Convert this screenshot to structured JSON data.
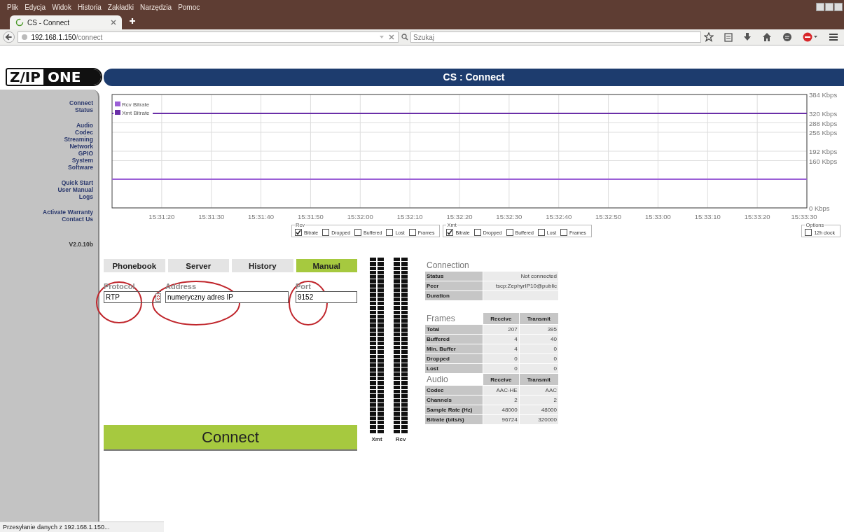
{
  "browser": {
    "menu": [
      "Plik",
      "Edycja",
      "Widok",
      "Historia",
      "Zakładki",
      "Narzędzia",
      "Pomoc"
    ],
    "tab": {
      "title": "CS - Connect"
    },
    "url": {
      "host": "192.168.1.150",
      "path": "/connect"
    },
    "search": {
      "placeholder": "Szukaj"
    },
    "status_bar": "Przesyłanie danych z 192.168.1.150..."
  },
  "header": {
    "logo_left": "Z/IP",
    "logo_right": "ONE",
    "title": "CS : Connect"
  },
  "sidebar": {
    "groups": [
      [
        "Connect",
        "Status"
      ],
      [
        "Audio",
        "Codec",
        "Streaming",
        "Network",
        "GPIO",
        "System",
        "Software"
      ],
      [
        "Quick Start",
        "User Manual",
        "Logs"
      ],
      [
        "Activate Warranty",
        "Contact Us"
      ]
    ],
    "version": "V2.0.10b"
  },
  "chart_data": {
    "type": "line",
    "grid": true,
    "legend": true,
    "categories": [
      null,
      "15:31:20",
      "15:31:30",
      "15:31:40",
      "15:31:50",
      "15:32:00",
      "15:32:10",
      "15:32:20",
      "15:32:30",
      "15:32:40",
      "15:32:50",
      "15:33:00",
      "15:33:10",
      "15:33:20",
      "15:33:30"
    ],
    "ylim": [
      0,
      384
    ],
    "yticks": [
      {
        "value": 0,
        "label": "0 Kbps"
      },
      {
        "value": 160,
        "label": "160 Kbps"
      },
      {
        "value": 192,
        "label": "192 Kbps"
      },
      {
        "value": 256,
        "label": "256 Kbps"
      },
      {
        "value": 288,
        "label": "288 Kbps"
      },
      {
        "value": 320,
        "label": "320 Kbps"
      },
      {
        "value": 384,
        "label": "384 Kbps"
      }
    ],
    "series": [
      {
        "name": "Rcv Bitrate",
        "color": "#9b5fd6",
        "values": [
          97,
          97,
          97,
          97,
          97,
          97,
          97,
          97,
          97,
          97,
          97,
          97,
          97,
          97,
          97
        ]
      },
      {
        "name": "Xmt Bitrate",
        "color": "#6a2fa8",
        "values": [
          320,
          320,
          320,
          320,
          320,
          320,
          320,
          320,
          320,
          320,
          320,
          320,
          320,
          320,
          320
        ]
      }
    ]
  },
  "graph_options": [
    {
      "title": "Rcv",
      "options": [
        {
          "label": "Bitrate",
          "checked": true
        },
        {
          "label": "Dropped",
          "checked": false
        },
        {
          "label": "Buffered",
          "checked": false
        },
        {
          "label": "Lost",
          "checked": false
        },
        {
          "label": "Frames",
          "checked": false
        }
      ]
    },
    {
      "title": "Xmt",
      "options": [
        {
          "label": "Bitrate",
          "checked": true
        },
        {
          "label": "Dropped",
          "checked": false
        },
        {
          "label": "Buffered",
          "checked": false
        },
        {
          "label": "Lost",
          "checked": false
        },
        {
          "label": "Frames",
          "checked": false
        }
      ]
    },
    {
      "title": "Options",
      "options": [
        {
          "label": "12h clock",
          "checked": false
        }
      ]
    }
  ],
  "mode_tabs": [
    {
      "label": "Phonebook",
      "selected": false
    },
    {
      "label": "Server",
      "selected": false
    },
    {
      "label": "History",
      "selected": false
    },
    {
      "label": "Manual",
      "selected": true
    }
  ],
  "fields": {
    "protocol": {
      "label": "Protocol",
      "value": "RTP"
    },
    "address": {
      "label": "Address",
      "value": "numeryczny adres IP"
    },
    "port": {
      "label": "Port",
      "value": "9152"
    }
  },
  "connect_button": "Connect",
  "meters": [
    "Xmt",
    "Rcv"
  ],
  "connection": {
    "title": "Connection",
    "rows": [
      [
        "Status",
        "Not connected"
      ],
      [
        "Peer",
        "tscp:ZephyrIP10@public"
      ],
      [
        "Duration",
        ""
      ]
    ]
  },
  "frames": {
    "columns": [
      "Frames",
      "Receive",
      "Transmit"
    ],
    "rows": [
      [
        "Total",
        "207",
        "395"
      ],
      [
        "Buffered",
        "4",
        "40"
      ],
      [
        "Min. Buffer",
        "4",
        "0"
      ],
      [
        "Dropped",
        "0",
        "0"
      ],
      [
        "Lost",
        "0",
        "0"
      ]
    ]
  },
  "audio": {
    "columns": [
      "Audio",
      "Receive",
      "Transmit"
    ],
    "rows": [
      [
        "Codec",
        "AAC-HE",
        "AAC"
      ],
      [
        "Channels",
        "2",
        "2"
      ],
      [
        "Sample Rate (Hz)",
        "48000",
        "48000"
      ],
      [
        "Bitrate (bits/s)",
        "96724",
        "320000"
      ]
    ]
  }
}
